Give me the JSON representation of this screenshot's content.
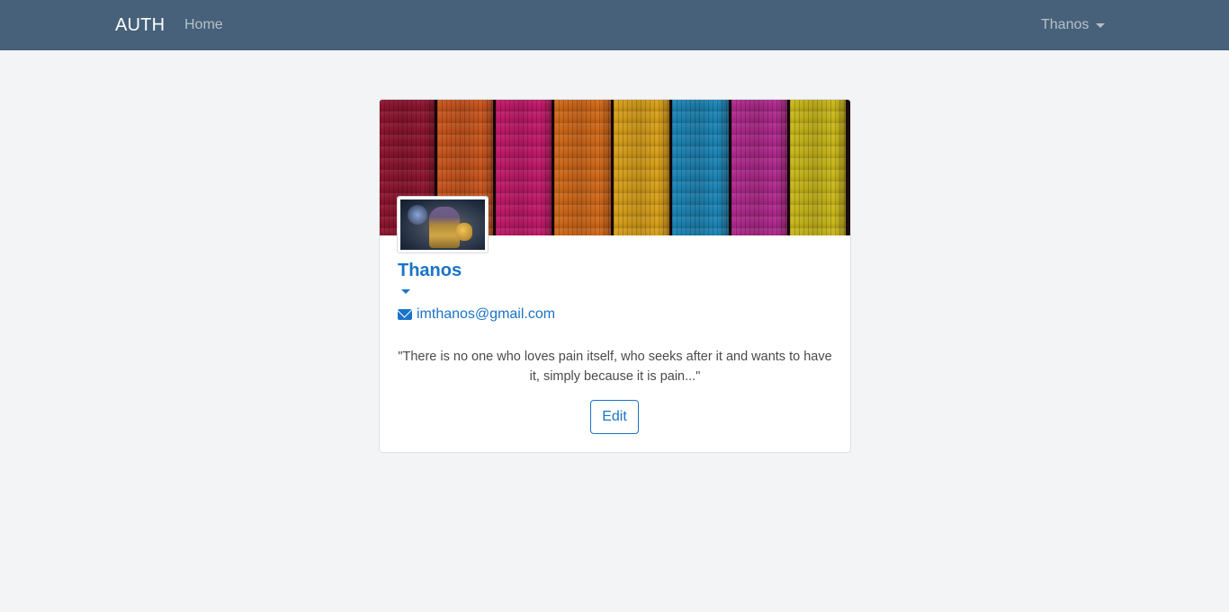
{
  "navbar": {
    "brand": "AUTH",
    "home_label": "Home",
    "user_label": "Thanos",
    "background": "#466179"
  },
  "profile": {
    "name": "Thanos",
    "email": "imthanos@gmail.com",
    "quote": "\"There is no one who loves pain itself, who seeks after it and wants to have it, simply because it is pain...\"",
    "edit_label": "Edit",
    "accent": "#1a73c8",
    "cover_image": "colorful-wood-planks",
    "avatar_image": "thanos-portrait",
    "icons": {
      "email": "envelope-icon",
      "name_menu": "caret-down-icon",
      "user_menu": "caret-down-icon"
    },
    "cover_colors": [
      "#8e1530",
      "#c9561e",
      "#c21a6b",
      "#d26a1a",
      "#d9a11a",
      "#1c86b8",
      "#b02a8e",
      "#c9b81a"
    ]
  }
}
